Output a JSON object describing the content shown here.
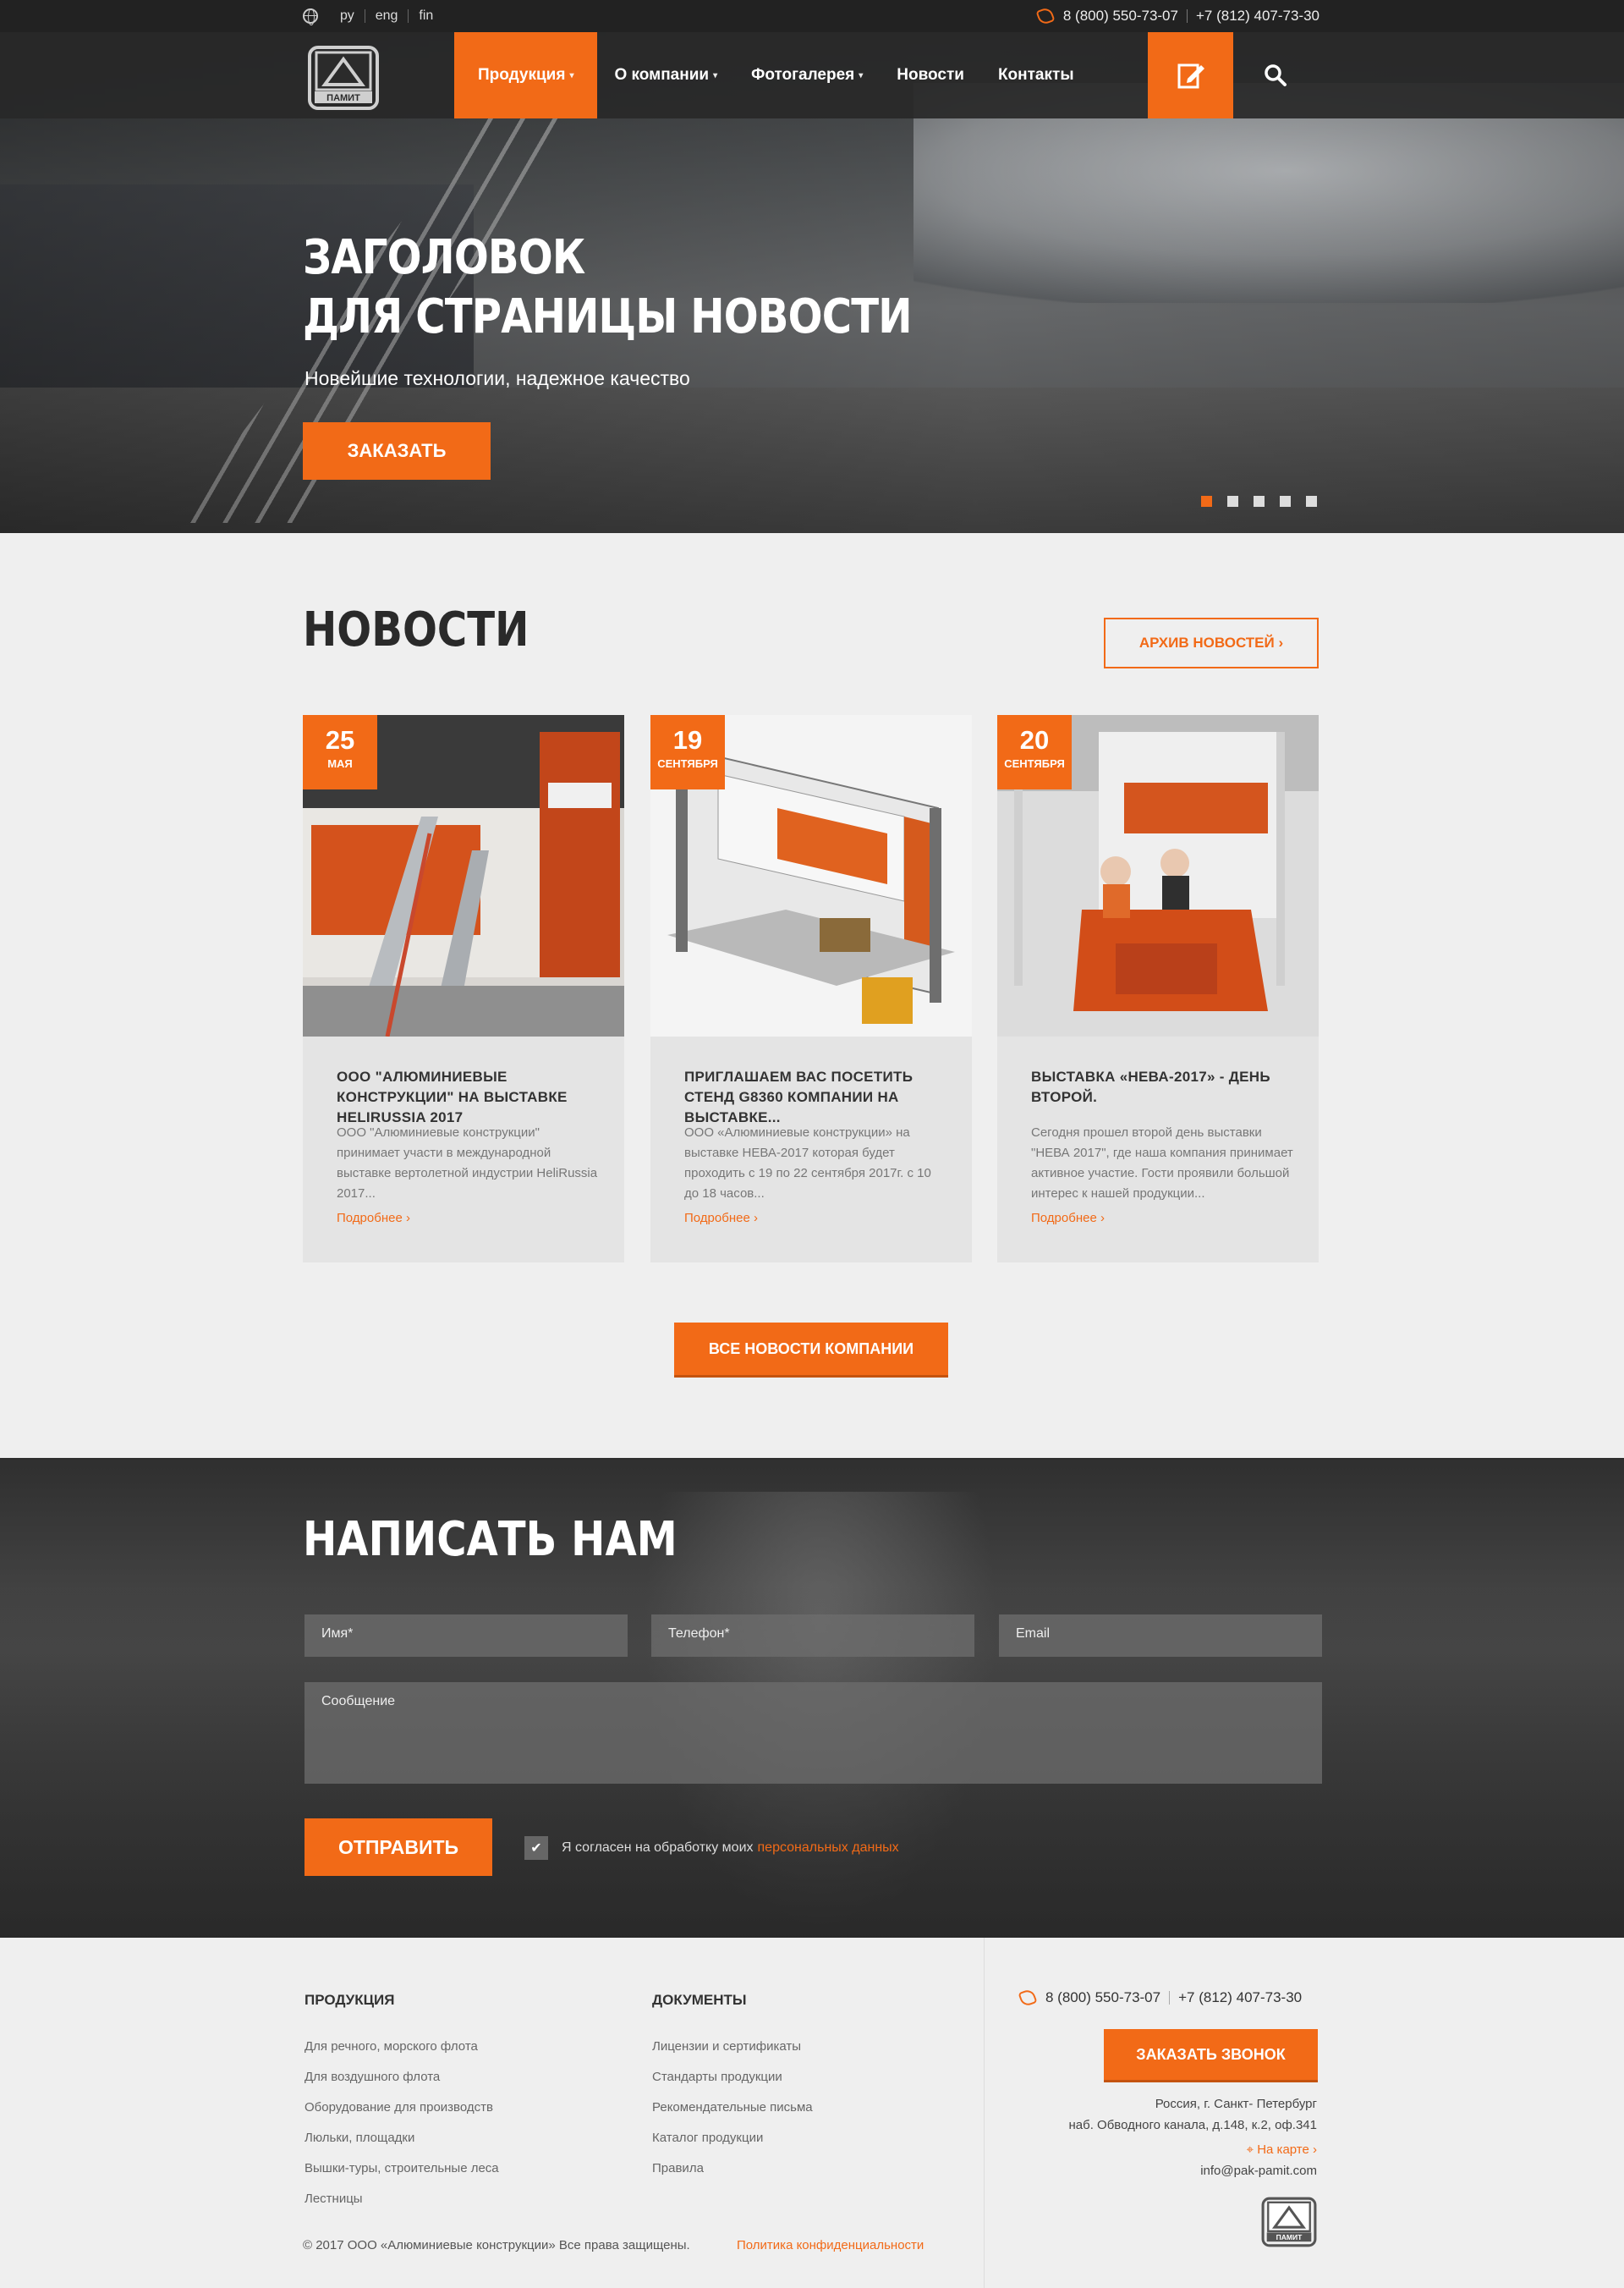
{
  "topbar": {
    "languages": [
      "ру",
      "eng",
      "fin"
    ],
    "phone1": "8 (800) 550-73-07",
    "phone2": "+7 (812) 407-73-30"
  },
  "logo": {
    "text": "ПАМИТ"
  },
  "nav": {
    "items": [
      {
        "label": "Продукция",
        "has_caret": true,
        "active": true
      },
      {
        "label": "О компании",
        "has_caret": true
      },
      {
        "label": "Фотогалерея",
        "has_caret": true
      },
      {
        "label": "Новости",
        "has_caret": false
      },
      {
        "label": "Контакты",
        "has_caret": false
      }
    ],
    "edit_icon": "edit-icon",
    "search_icon": "search-icon"
  },
  "hero": {
    "title_line1": "ЗАГОЛОВОК",
    "title_line2": "ДЛЯ СТРАНИЦЫ НОВОСТИ",
    "subtitle": "Новейшие технологии, надежное качество",
    "button": "ЗАКАЗАТЬ",
    "slides_count": 5,
    "active_slide": 1
  },
  "news": {
    "title": "НОВОСТИ",
    "archive_button": "АРХИВ НОВОСТЕЙ ›",
    "cards": [
      {
        "day": "25",
        "month": "МАЯ",
        "title": "ООО \"АЛЮМИНИЕВЫЕ КОНСТРУКЦИИ\" НА ВЫСТАВКЕ HELIRUSSIA 2017",
        "text": "ООО \"Алюминиевые конструкции\" принимает участи в международной выставке вертолетной индустрии HeliRussia 2017...",
        "more": "Подробнее ›"
      },
      {
        "day": "19",
        "month": "СЕНТЯБРЯ",
        "title": "ПРИГЛАШАЕМ ВАС ПОСЕТИТЬ СТЕНД G8360 КОМПАНИИ НА ВЫСТАВКЕ...",
        "text": "ООО «Алюминиевые конструкции» на выставке НЕВА-2017 которая будет проходить с 19 по 22 сентября 2017г. с 10 до 18 часов...",
        "more": "Подробнее ›"
      },
      {
        "day": "20",
        "month": "СЕНТЯБРЯ",
        "title": "ВЫСТАВКА «НЕВА-2017» - ДЕНЬ ВТОРОЙ.",
        "text": "Сегодня прошел второй день выставки \"НЕВА 2017\", где наша компания принимает активное участие. Гости проявили большой интерес к нашей продукции...",
        "more": "Подробнее ›"
      }
    ],
    "all_button": "ВСЕ НОВОСТИ КОМПАНИИ"
  },
  "contact_form": {
    "title": "НАПИСАТЬ НАМ",
    "name_placeholder": "Имя*",
    "phone_placeholder": "Телефон*",
    "email_placeholder": "Email",
    "message_placeholder": "Сообщение",
    "send_button": "ОТПРАВИТЬ",
    "agree_text": "Я согласен на обработку моих",
    "agree_link": "персональных данных",
    "agree_checked": true
  },
  "footer": {
    "products_title": "ПРОДУКЦИЯ",
    "products": [
      "Для речного, морского флота",
      "Для воздушного флота",
      "Оборудование для производств",
      "Люльки, площадки",
      "Вышки-туры, строительные леса",
      "Лестницы"
    ],
    "docs_title": "ДОКУМЕНТЫ",
    "docs": [
      "Лицензии и сертификаты",
      "Стандарты продукции",
      "Рекомендательные письма",
      "Каталог продукции",
      "Правила"
    ],
    "phone1": "8 (800) 550-73-07",
    "phone2": "+7 (812) 407-73-30",
    "call_button": "ЗАКАЗАТЬ ЗВОНОК",
    "address_line1": "Россия, г. Санкт- Петербург",
    "address_line2": "наб. Обводного канала, д.148, к.2, оф.341",
    "map_link": "На карте ›",
    "email": "info@pak-pamit.com",
    "copyright": "© 2017 ООО «Алюминиевые конструкции» Все права защищены.",
    "policy_link": "Политика конфиденциальности"
  },
  "colors": {
    "accent": "#f26a17",
    "topbar": "#222222",
    "nav": "#282828",
    "footer_bg": "#efefef"
  }
}
